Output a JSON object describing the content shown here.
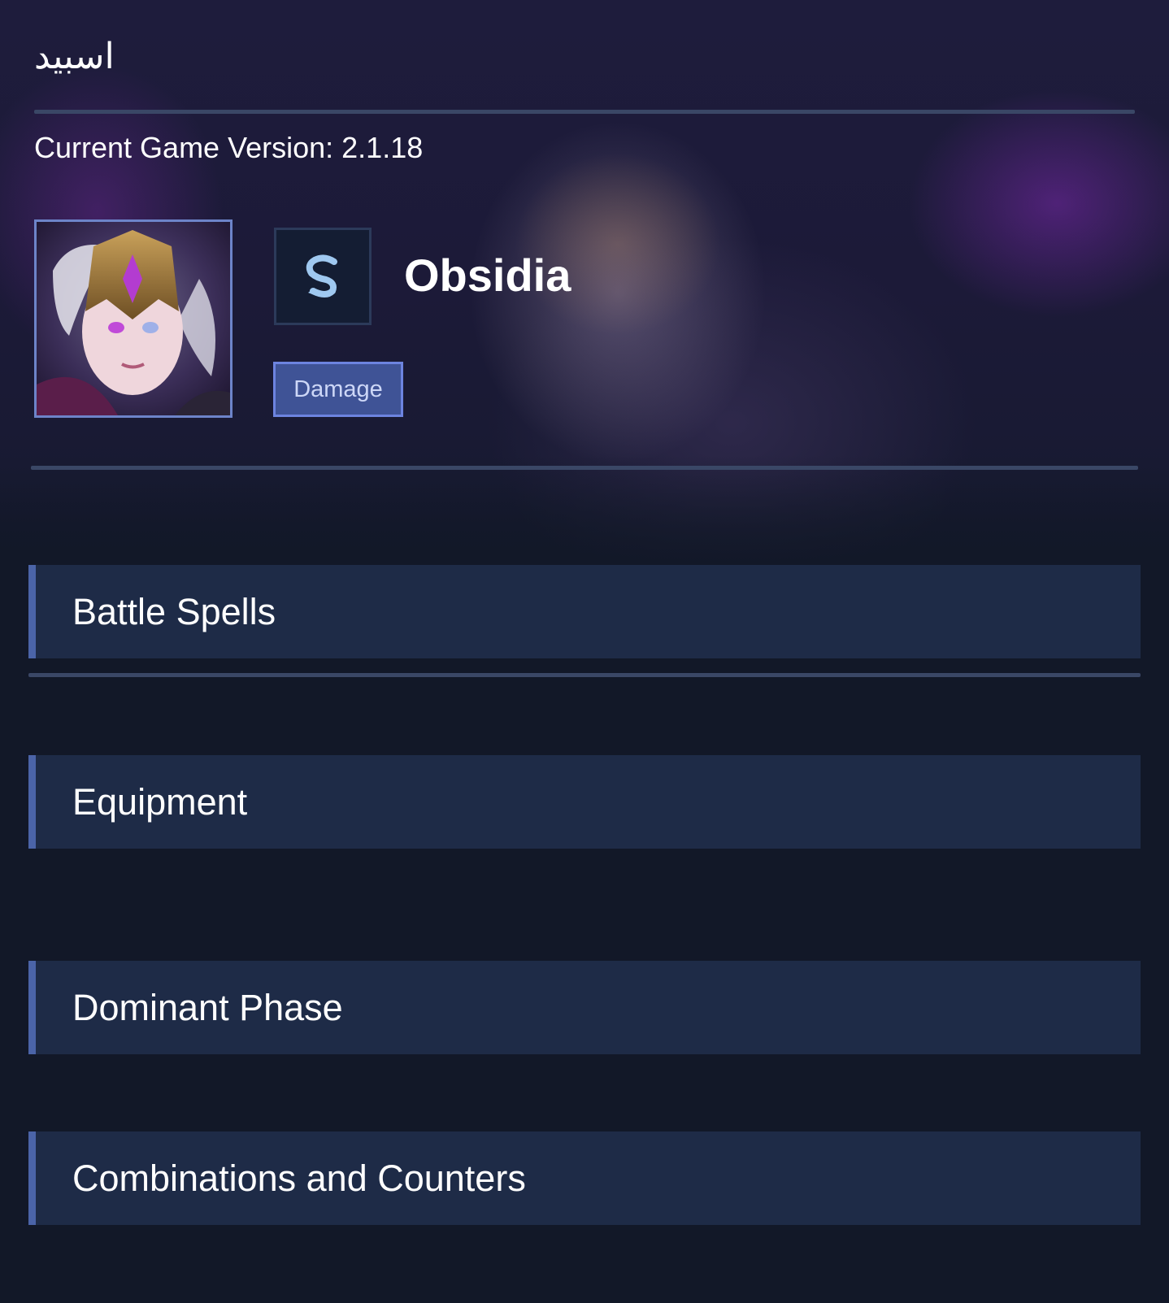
{
  "header": {
    "arabic_title": "اسبيد",
    "version_text": "Current Game Version: 2.1.18"
  },
  "hero": {
    "name": "Obsidia",
    "role_tag": "Damage",
    "role_icon": "role-s-icon",
    "portrait": "hero-portrait"
  },
  "sections": [
    {
      "label": "Battle Spells"
    },
    {
      "label": "Equipment"
    },
    {
      "label": "Dominant Phase"
    },
    {
      "label": "Combinations and Counters"
    }
  ],
  "colors": {
    "background": "#121828",
    "section_bg": "#1e2b47",
    "section_accent": "#4b64a8",
    "divider": "#3a4766",
    "tag_bg": "#3f5396",
    "tag_border": "#6d84e0",
    "portrait_border": "#6d84c9"
  }
}
